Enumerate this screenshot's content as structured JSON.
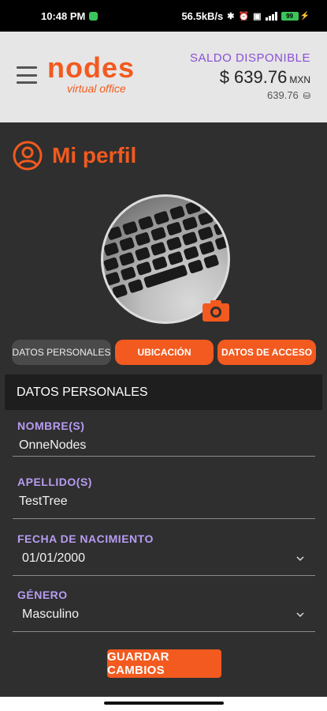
{
  "status_bar": {
    "time": "10:48 PM",
    "net_speed": "56.5kB/s",
    "battery": "99"
  },
  "header": {
    "logo_main": "nodes",
    "logo_sub": "virtual office",
    "balance_label": "SALDO DISPONIBLE",
    "balance_amount": "$ 639.76",
    "balance_currency": "MXN",
    "balance_points": "639.76"
  },
  "profile": {
    "title": "Mi perfil"
  },
  "tabs": [
    {
      "label": "DATOS PERSONALES"
    },
    {
      "label": "UBICACIÓN"
    },
    {
      "label": "DATOS DE ACCESO"
    }
  ],
  "section": {
    "title": "DATOS PERSONALES"
  },
  "fields": {
    "nombre": {
      "label": "NOMBRE(S)",
      "value": "OnneNodes"
    },
    "apellido": {
      "label": "APELLIDO(S)",
      "value": "TestTree"
    },
    "fecha": {
      "label": "FECHA DE NACIMIENTO",
      "value": "01/01/2000"
    },
    "genero": {
      "label": "GÉNERO",
      "value": "Masculino"
    }
  },
  "actions": {
    "save_label": "GUARDAR CAMBIOS"
  },
  "colors": {
    "accent": "#f25a1f",
    "label": "#b79cf2",
    "balance_label": "#8a4fd6",
    "background": "#2f2f2f"
  },
  "icons": [
    "hamburger-menu-icon",
    "user-circle-icon",
    "camera-icon",
    "chevron-down-icon",
    "coins-icon"
  ]
}
